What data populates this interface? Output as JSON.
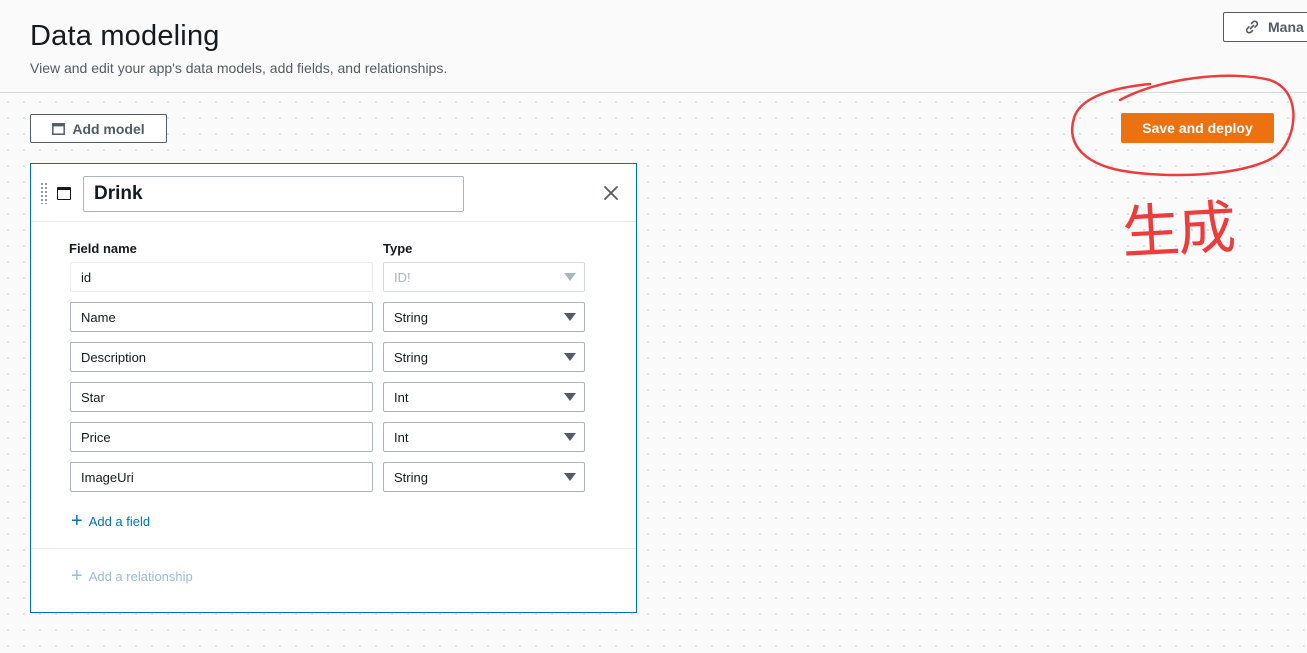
{
  "header": {
    "title": "Data modeling",
    "subtitle": "View and edit your app's data models, add fields, and relationships.",
    "manage_label": "Mana"
  },
  "toolbar": {
    "add_model_label": "Add model",
    "save_deploy_label": "Save and deploy"
  },
  "annotation": {
    "text": "生成",
    "color": "#ee3b3b"
  },
  "model": {
    "name": "Drink",
    "col_field_name": "Field name",
    "col_type": "Type",
    "fields": [
      {
        "name": "id",
        "type": "ID!",
        "disabled": true
      },
      {
        "name": "Name",
        "type": "String",
        "disabled": false
      },
      {
        "name": "Description",
        "type": "String",
        "disabled": false
      },
      {
        "name": "Star",
        "type": "Int",
        "disabled": false
      },
      {
        "name": "Price",
        "type": "Int",
        "disabled": false
      },
      {
        "name": "ImageUri",
        "type": "String",
        "disabled": false
      }
    ],
    "add_field_label": "Add a field",
    "add_relationship_label": "Add a relationship"
  },
  "colors": {
    "accent_orange": "#ec7211",
    "link_blue": "#0073bb",
    "card_border": "#0073bb"
  },
  "icons": [
    "link-icon",
    "table-icon",
    "drag-handle-icon",
    "close-icon",
    "plus-icon",
    "dropdown-caret-icon"
  ]
}
